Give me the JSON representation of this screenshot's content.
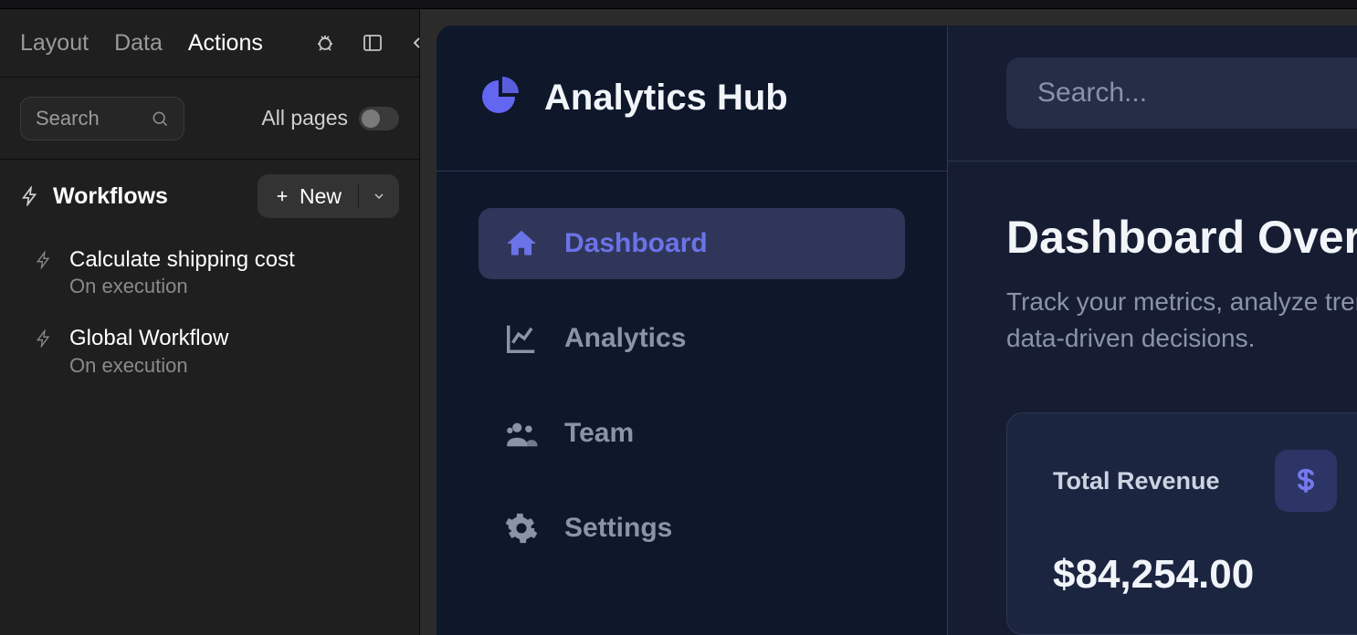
{
  "editor": {
    "tabs": {
      "layout": "Layout",
      "data": "Data",
      "actions": "Actions"
    },
    "search_placeholder": "Search",
    "all_pages_label": "All pages",
    "workflows_title": "Workflows",
    "new_label": "New",
    "items": [
      {
        "name": "Calculate shipping cost",
        "trigger": "On execution"
      },
      {
        "name": "Global Workflow",
        "trigger": "On execution"
      }
    ]
  },
  "app": {
    "name": "Analytics Hub",
    "search_placeholder": "Search...",
    "nav": [
      {
        "key": "dashboard",
        "label": "Dashboard",
        "active": true
      },
      {
        "key": "analytics",
        "label": "Analytics",
        "active": false
      },
      {
        "key": "team",
        "label": "Team",
        "active": false
      },
      {
        "key": "settings",
        "label": "Settings",
        "active": false
      }
    ],
    "page": {
      "title": "Dashboard Overview",
      "subtitle_line1": "Track your metrics, analyze trends, and make",
      "subtitle_line2": "data-driven decisions."
    },
    "card": {
      "label": "Total Revenue",
      "value": "$84,254.00"
    }
  }
}
